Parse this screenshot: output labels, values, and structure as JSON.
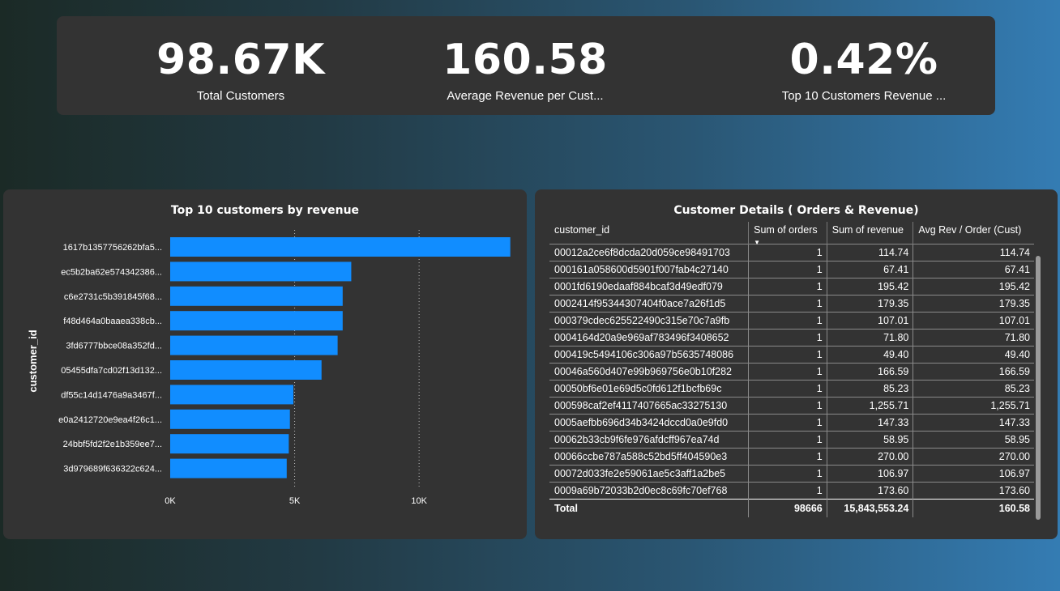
{
  "kpis": [
    {
      "value": "98.67K",
      "label": "Total Customers"
    },
    {
      "value": "160.58",
      "label": "Average Revenue per Cust..."
    },
    {
      "value": "0.42%",
      "label": "Top 10 Customers Revenue ..."
    }
  ],
  "chart": {
    "title": "Top 10 customers by revenue",
    "ylabel": "customer_id"
  },
  "chart_data": {
    "type": "bar",
    "orientation": "horizontal",
    "title": "Top 10 customers by revenue",
    "xlabel": "",
    "ylabel": "customer_id",
    "categories": [
      "1617b1357756262bfa5...",
      "ec5b2ba62e574342386...",
      "c6e2731c5b391845f68...",
      "f48d464a0baaea338cb...",
      "3fd6777bbce08a352fd...",
      "05455dfa7cd02f13d132...",
      "df55c14d1476a9a3467f...",
      "e0a2412720e9ea4f26c1...",
      "24bbf5fd2f2e1b359ee7...",
      "3d979689f636322c624..."
    ],
    "values": [
      13664,
      7275,
      6930,
      6930,
      6727,
      6081,
      4950,
      4810,
      4765,
      4682
    ],
    "xticks": [
      "0K",
      "5K",
      "10K"
    ],
    "xtick_values": [
      0,
      5000,
      10000
    ],
    "xlim": [
      0,
      14000
    ],
    "grid": "vertical dotted",
    "bar_color": "#118dff"
  },
  "table": {
    "title": "Customer Details ( Orders & Revenue)",
    "columns": [
      "customer_id",
      "Sum of orders",
      "Sum of revenue",
      "Avg Rev / Order (Cust)"
    ],
    "rows": [
      [
        "00012a2ce6f8dcda20d059ce98491703",
        "1",
        "114.74",
        "114.74"
      ],
      [
        "000161a058600d5901f007fab4c27140",
        "1",
        "67.41",
        "67.41"
      ],
      [
        "0001fd6190edaaf884bcaf3d49edf079",
        "1",
        "195.42",
        "195.42"
      ],
      [
        "0002414f95344307404f0ace7a26f1d5",
        "1",
        "179.35",
        "179.35"
      ],
      [
        "000379cdec625522490c315e70c7a9fb",
        "1",
        "107.01",
        "107.01"
      ],
      [
        "0004164d20a9e969af783496f3408652",
        "1",
        "71.80",
        "71.80"
      ],
      [
        "000419c5494106c306a97b5635748086",
        "1",
        "49.40",
        "49.40"
      ],
      [
        "00046a560d407e99b969756e0b10f282",
        "1",
        "166.59",
        "166.59"
      ],
      [
        "00050bf6e01e69d5c0fd612f1bcfb69c",
        "1",
        "85.23",
        "85.23"
      ],
      [
        "000598caf2ef4117407665ac33275130",
        "1",
        "1,255.71",
        "1,255.71"
      ],
      [
        "0005aefbb696d34b3424dccd0a0e9fd0",
        "1",
        "147.33",
        "147.33"
      ],
      [
        "00062b33cb9f6fe976afdcff967ea74d",
        "1",
        "58.95",
        "58.95"
      ],
      [
        "00066ccbe787a588c52bd5ff404590e3",
        "1",
        "270.00",
        "270.00"
      ],
      [
        "00072d033fe2e59061ae5c3aff1a2be5",
        "1",
        "106.97",
        "106.97"
      ],
      [
        "0009a69b72033b2d0ec8c69fc70ef768",
        "1",
        "173.60",
        "173.60"
      ]
    ],
    "total": [
      "Total",
      "98666",
      "15,843,553.24",
      "160.58"
    ]
  }
}
